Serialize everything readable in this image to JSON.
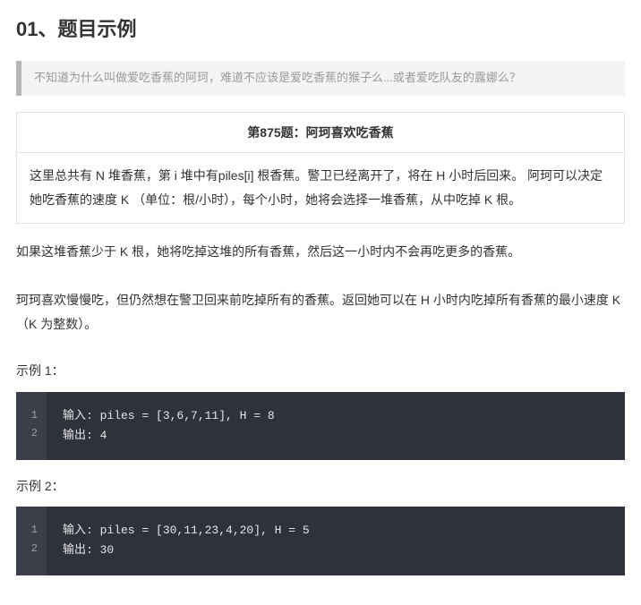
{
  "section_title": "01、题目示例",
  "quote": "不知道为什么叫做爱吃香蕉的阿珂，难道不应该是爱吃香蕉的猴子么...或者爱吃队友的露娜么？",
  "problem": {
    "title": "第875题：阿珂喜欢吃香蕉",
    "description": "这里总共有 N 堆香蕉，第 i 堆中有piles[i] 根香蕉。警卫已经离开了，将在 H 小时后回来。 阿珂可以决定她吃香蕉的速度 K （单位：根/小时），每个小时，她将会选择一堆香蕉，从中吃掉 K 根。"
  },
  "paragraphs": {
    "p1": "如果这堆香蕉少于 K 根，她将吃掉这堆的所有香蕉，然后这一小时内不会再吃更多的香蕉。",
    "p2": "珂珂喜欢慢慢吃，但仍然想在警卫回来前吃掉所有的香蕉。返回她可以在 H 小时内吃掉所有香蕉的最小速度 K（K 为整数）。"
  },
  "examples": [
    {
      "label": "示例 1：",
      "lines": [
        "输入: piles = [3,6,7,11], H = 8",
        "输出: 4"
      ]
    },
    {
      "label": "示例 2：",
      "lines": [
        "输入: piles = [30,11,23,4,20], H = 5",
        "输出: 30"
      ]
    }
  ]
}
